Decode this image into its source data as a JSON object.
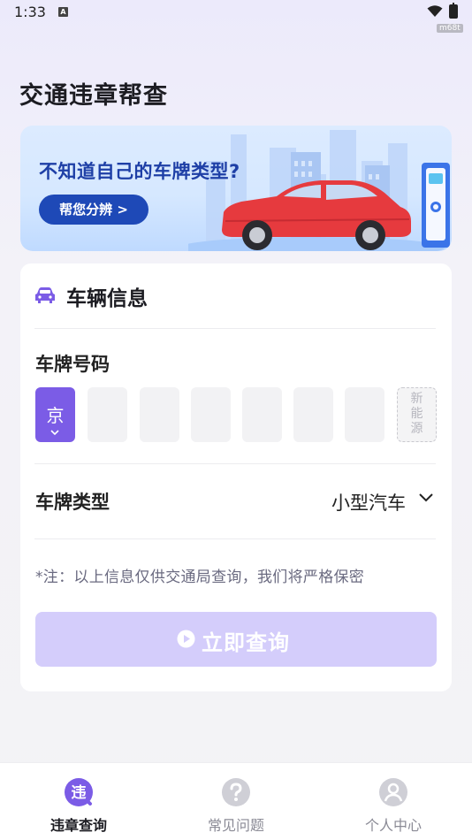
{
  "status_bar": {
    "time": "1:33",
    "notification_icon": "A",
    "wifi_icon": "wifi-icon",
    "battery_icon": "battery-icon",
    "watermark": "m68t"
  },
  "header": {
    "title": "交通违章帮查"
  },
  "banner": {
    "headline": "不知道自己的车牌类型?",
    "button_label": "帮您分辨 >",
    "illustration": "red-car-city-charging-station"
  },
  "vehicle_card": {
    "title": "车辆信息",
    "title_icon": "car-icon",
    "plate_label": "车牌号码",
    "province": "京",
    "plate_chars": [
      "",
      "",
      "",
      "",
      "",
      ""
    ],
    "new_energy_label": [
      "新",
      "能",
      "源"
    ],
    "type_label": "车牌类型",
    "type_value": "小型汽车",
    "note": "*注：以上信息仅供交通局查询，我们将严格保密",
    "query_button": "立即查询"
  },
  "bottom_nav": {
    "items": [
      {
        "label": "违章查询",
        "icon": "violation-query-icon",
        "icon_text": "违",
        "active": true
      },
      {
        "label": "常见问题",
        "icon": "question-icon",
        "active": false
      },
      {
        "label": "个人中心",
        "icon": "user-icon",
        "active": false
      }
    ]
  },
  "colors": {
    "accent": "#7B5CE6",
    "banner_button": "#1E49B7",
    "banner_text": "#1E3FA6",
    "query_button_disabled": "#D4CDFB"
  }
}
